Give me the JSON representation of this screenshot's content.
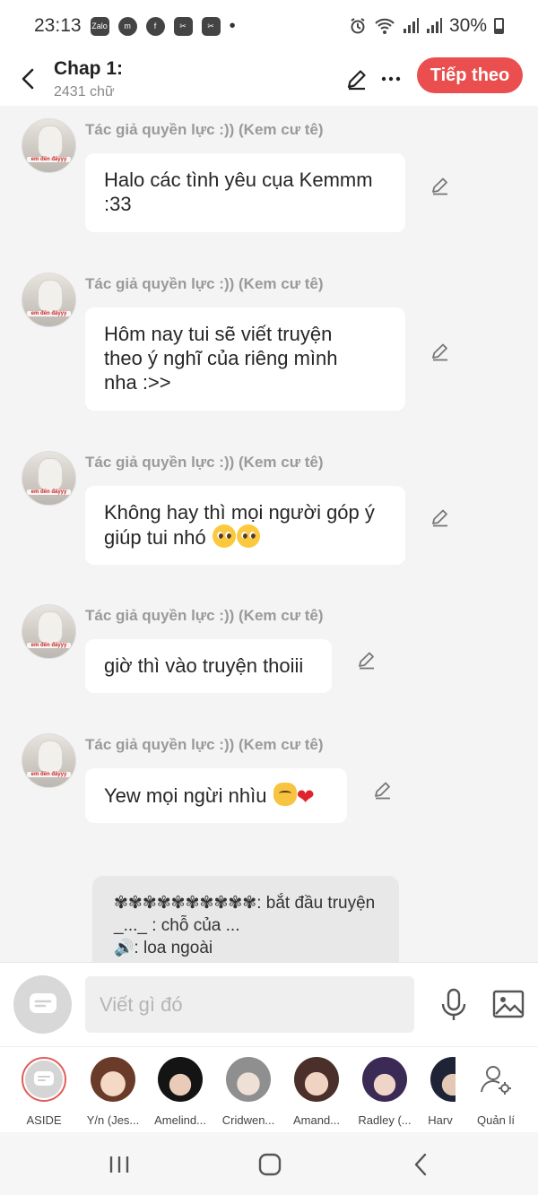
{
  "status_bar": {
    "time": "23:13",
    "apps": [
      "Zalo",
      "m",
      "f",
      "✂",
      "✂"
    ],
    "battery": "30%"
  },
  "header": {
    "title": "Chap 1:",
    "word_count": "2431 chữ",
    "next_label": "Tiếp theo"
  },
  "messages": [
    {
      "author": "Tác giả quyền lực :)) (Kem cư tê)",
      "line1": "Halo các tình yêu cụa Kemmm",
      "line2": ":33",
      "line3": ""
    },
    {
      "author": "Tác giả quyền lực :)) (Kem cư tê)",
      "line1": "Hôm nay tui sẽ viết truyện",
      "line2": "theo ý nghĩ của riêng mình",
      "line3": "nha :>>"
    },
    {
      "author": "Tác giả quyền lực :)) (Kem cư tê)",
      "line1": "Không hay thì mọi người góp ý",
      "line2": "giúp tui nhó",
      "line3": ""
    },
    {
      "author": "Tác giả quyền lực :)) (Kem cư tê)",
      "line1": "giờ thì vào truyện thoiii",
      "line2": "",
      "line3": ""
    },
    {
      "author": "Tác giả quyền lực :)) (Kem cư tê)",
      "line1": "Yew mọi ngừi nhìu",
      "line2": "",
      "line3": ""
    }
  ],
  "avatar_caption": "em đến đâyyy",
  "aside_card": {
    "line1": "✾✾✾✾✾✾✾✾✾✾: bắt đầu truyện",
    "line2": "_..._ : chỗ của ...",
    "line3": ": loa ngoài"
  },
  "composer": {
    "placeholder": "Viết gì đó"
  },
  "characters": [
    {
      "name": "ASIDE"
    },
    {
      "name": "Y/n (Jes..."
    },
    {
      "name": "Amelind..."
    },
    {
      "name": "Cridwen..."
    },
    {
      "name": "Amand..."
    },
    {
      "name": "Radley (..."
    },
    {
      "name": "Harv"
    },
    {
      "name": "Quản lí"
    }
  ],
  "colors": {
    "accent": "#ea4e4e",
    "background": "#f4f4f4",
    "bubble": "#ffffff",
    "muted_text": "#9a9a9a"
  }
}
